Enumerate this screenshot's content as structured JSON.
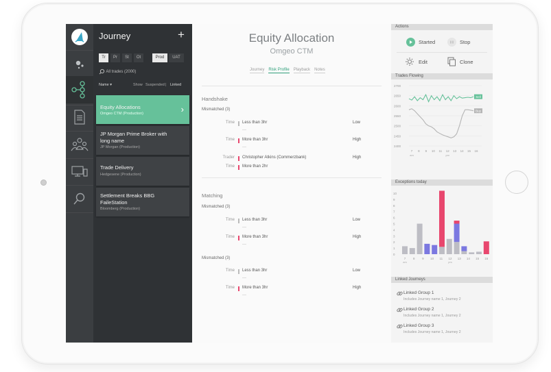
{
  "sidebar": {
    "title": "Journey",
    "add_label": "+",
    "env_tabs": [
      "Tr",
      "Pr",
      "St",
      "Ot"
    ],
    "stage_tabs": [
      "Prod",
      "UAT"
    ],
    "search_label": "All trades (2000)",
    "sort_label": "Name ▾",
    "show_label": "Show",
    "suspended_label": "Suspended",
    "separator": "|",
    "linked_label": "Linked",
    "items": [
      {
        "name": "Equity Allocations",
        "sub": "Omgeo CTM (Production)"
      },
      {
        "name": "JP Morgan Prime Broker with long name",
        "sub": "JP Morgan (Production)"
      },
      {
        "name": "Trade Delivery",
        "sub": "Hedgesene (Production)"
      },
      {
        "name": "Settlement Breaks BBG FaileStation",
        "sub": "Bloomberg (Production)"
      }
    ]
  },
  "main": {
    "title": "Equity Allocation",
    "subtitle": "Omgeo CTM",
    "tabs": [
      "Journey",
      "Risk Profile",
      "Playback",
      "Notes"
    ],
    "sections": [
      {
        "title": "Handshake"
      },
      {
        "title": "Matching"
      }
    ],
    "groups": [
      {
        "label": "Mismatched (3)",
        "rows": [
          {
            "label": "Time",
            "value": "Less than  3hr",
            "level": "Low",
            "flag": "gray"
          },
          {
            "label": "Time",
            "value": "More than  3hr",
            "level": "High",
            "flag": "red"
          },
          {
            "label": "Trader",
            "value": "Christopher Atkins (Commerzbank)",
            "level": "High",
            "flag": "red"
          },
          {
            "label": "Time",
            "value": "More than  2hr",
            "level": "",
            "flag": "red"
          }
        ]
      },
      {
        "label": "Mismatched (3)",
        "rows": [
          {
            "label": "Time",
            "value": "Less than  3hr",
            "level": "Low",
            "flag": "gray"
          },
          {
            "label": "Time",
            "value": "More than  3hr",
            "level": "High",
            "flag": "red"
          }
        ]
      },
      {
        "label": "Mismatched (3)",
        "rows": [
          {
            "label": "Time",
            "value": "Less than  3hr",
            "level": "Low",
            "flag": "gray"
          },
          {
            "label": "Time",
            "value": "More than  3hr",
            "level": "High",
            "flag": "red"
          }
        ]
      }
    ],
    "dash": "—"
  },
  "right": {
    "actions_header": "Actions",
    "actions": {
      "started": "Started",
      "stop": "Stop",
      "edit": "Edit",
      "clone": "Clone"
    },
    "trades_header": "Trades Flowing",
    "exceptions_header": "Exceptions today",
    "linked_header": "Linked Journeys",
    "linked": [
      {
        "title": "Linked Group 1",
        "desc": "Includes Journey name 1, Journey 2"
      },
      {
        "title": "Linked Group 2",
        "desc": "Includes Journey name 1, Journey 2"
      },
      {
        "title": "Linked Group 3",
        "desc": "Includes Journey name 1, Journey 2"
      }
    ]
  },
  "colors": {
    "accent": "#66c19a",
    "red": "#e8476e",
    "purple": "#7b78e0",
    "gray": "#bdbdc4"
  },
  "chart_data": [
    {
      "type": "line",
      "y_ticks": [
        2700,
        2650,
        2600,
        2550,
        2500,
        2450,
        2400
      ],
      "x_ticks": [
        "7",
        "8",
        "9",
        "10",
        "11",
        "12",
        "13",
        "14",
        "15",
        "16"
      ],
      "x_period_labels": [
        "am",
        "pm"
      ],
      "series": [
        {
          "name": "Sell",
          "color": "#66c19a",
          "values": [
            2635,
            2628,
            2645,
            2625,
            2640,
            2630,
            2655,
            2620,
            2650,
            2630,
            2645,
            2625,
            2655,
            2630,
            2645,
            2625,
            2650,
            2635,
            2645,
            2638,
            2640,
            2642,
            2640,
            2645
          ]
        },
        {
          "name": "Buy",
          "color": "#b5b5b5",
          "values": [
            2580,
            2585,
            2575,
            2560,
            2545,
            2530,
            2510,
            2500,
            2495,
            2485,
            2470,
            2462,
            2455,
            2450,
            2445,
            2440,
            2445,
            2460,
            2500,
            2550,
            2580,
            2580,
            2578,
            2575
          ]
        }
      ]
    },
    {
      "type": "bar",
      "y_ticks": [
        10,
        9,
        8,
        7,
        6,
        5,
        4,
        3,
        2,
        1,
        0
      ],
      "x_ticks": [
        "7",
        "8",
        "9",
        "10",
        "11",
        "12",
        "13",
        "14",
        "15",
        "16"
      ],
      "x_period_labels": [
        "am",
        "pm"
      ],
      "series": [
        {
          "name": "",
          "color": "#bdbdc4",
          "values": [
            1.3,
            1.0,
            5.0,
            0.0,
            0.0,
            1.2,
            2.5,
            2.0,
            0.5,
            0.3,
            0.4,
            0.0
          ]
        },
        {
          "name": "",
          "color": "#7b78e0",
          "values": [
            0.0,
            0.0,
            0.0,
            1.7,
            1.5,
            0.0,
            0.0,
            3.0,
            0.8,
            0.0,
            0.0,
            0.0
          ]
        },
        {
          "name": "",
          "color": "#e8476e",
          "values": [
            0.0,
            0.0,
            0.0,
            0.0,
            0.0,
            9.2,
            0.0,
            0.5,
            0.0,
            0.0,
            0.0,
            2.1
          ]
        }
      ]
    }
  ]
}
